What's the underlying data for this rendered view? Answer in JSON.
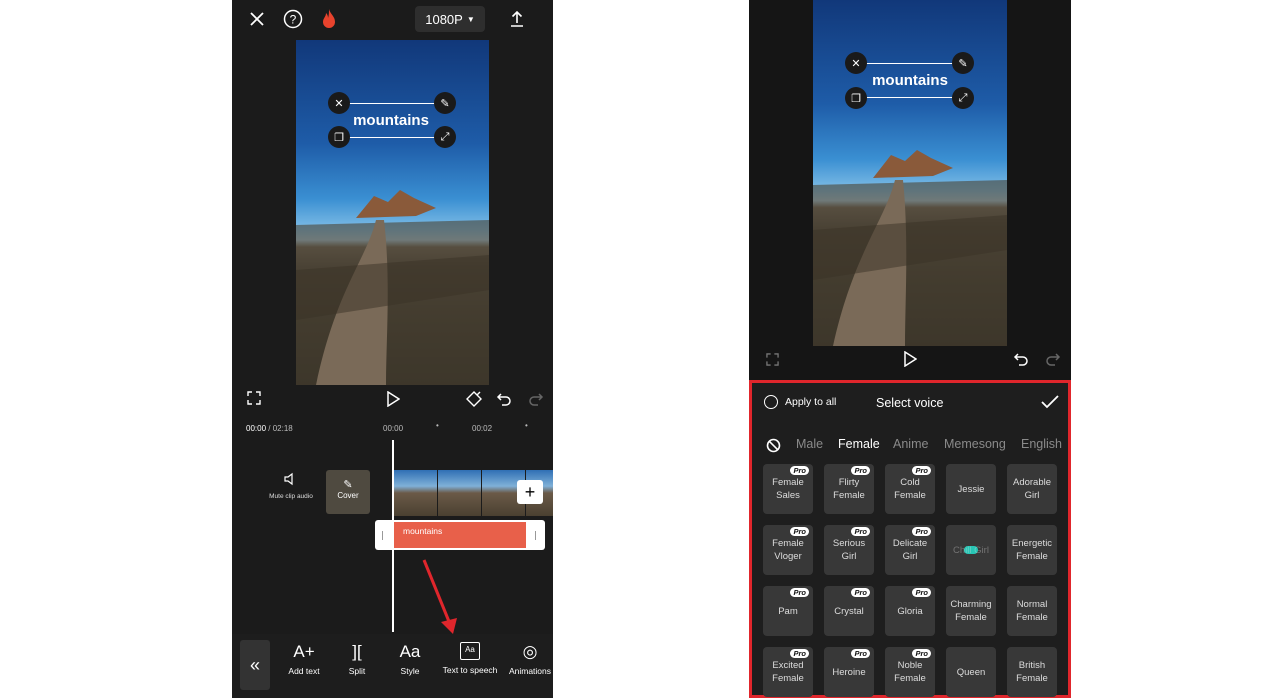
{
  "left": {
    "header": {
      "resolution": "1080P"
    },
    "preview": {
      "text": "mountains"
    },
    "timeline": {
      "current_time": "00:00",
      "total_time": "02:18",
      "ruler_marks": [
        "00:00",
        "00:02"
      ],
      "mute_label": "Mute clip audio",
      "cover_label": "Cover",
      "text_clip": "mountains"
    },
    "toolbar": [
      {
        "label": "Add text",
        "icon": "add-text-icon"
      },
      {
        "label": "Split",
        "icon": "split-icon"
      },
      {
        "label": "Style",
        "icon": "style-icon"
      },
      {
        "label": "Text to speech",
        "icon": "text-to-speech-icon"
      },
      {
        "label": "Animations",
        "icon": "animations-icon"
      }
    ]
  },
  "right": {
    "preview": {
      "text": "mountains"
    },
    "panel": {
      "apply_label": "Apply to all",
      "title": "Select voice",
      "categories": [
        "Male",
        "Female",
        "Anime",
        "Memesong",
        "English"
      ],
      "active_category": "Female",
      "pro_badge": "Pro",
      "voices": [
        {
          "line1": "Female",
          "line2": "Sales",
          "pro": true
        },
        {
          "line1": "Flirty",
          "line2": "Female",
          "pro": true
        },
        {
          "line1": "Cold",
          "line2": "Female",
          "pro": true
        },
        {
          "line1": "Jessie",
          "line2": "",
          "pro": false
        },
        {
          "line1": "Adorable",
          "line2": "Girl",
          "pro": false
        },
        {
          "line1": "Female",
          "line2": "Vloger",
          "pro": true
        },
        {
          "line1": "Serious",
          "line2": "Girl",
          "pro": true
        },
        {
          "line1": "Delicate",
          "line2": "Girl",
          "pro": true
        },
        {
          "line1": "Chill Girl",
          "line2": "",
          "pro": false,
          "loading": true
        },
        {
          "line1": "Energetic",
          "line2": "Female",
          "pro": false
        },
        {
          "line1": "Pam",
          "line2": "",
          "pro": true
        },
        {
          "line1": "Crystal",
          "line2": "",
          "pro": true
        },
        {
          "line1": "Gloria",
          "line2": "",
          "pro": true
        },
        {
          "line1": "Charming",
          "line2": "Female",
          "pro": false
        },
        {
          "line1": "Normal",
          "line2": "Female",
          "pro": false
        },
        {
          "line1": "Excited",
          "line2": "Female",
          "pro": true
        },
        {
          "line1": "Heroine",
          "line2": "",
          "pro": true
        },
        {
          "line1": "Noble",
          "line2": "Female",
          "pro": true
        },
        {
          "line1": "Queen",
          "line2": "",
          "pro": false
        },
        {
          "line1": "British",
          "line2": "Female",
          "pro": false
        }
      ]
    }
  },
  "colors": {
    "highlight": "#e0262c",
    "text_clip": "#e8604a",
    "accent_teal": "#27c6b5"
  }
}
